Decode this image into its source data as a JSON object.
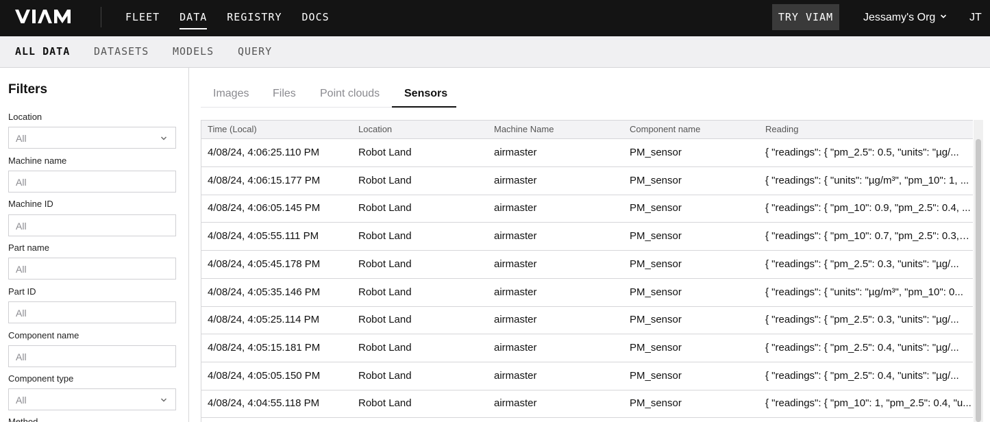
{
  "header": {
    "logo": "VIAM",
    "nav": [
      "FLEET",
      "DATA",
      "REGISTRY",
      "DOCS"
    ],
    "active_nav": "DATA",
    "try_button": "TRY VIAM",
    "org_name": "Jessamy's Org",
    "user_initials": "JT",
    "icons": {
      "org_dropdown": "chevron-down-icon"
    }
  },
  "subnav": {
    "items": [
      "ALL DATA",
      "DATASETS",
      "MODELS",
      "QUERY"
    ],
    "active": "ALL DATA"
  },
  "sidebar": {
    "title": "Filters",
    "filters": [
      {
        "label": "Location",
        "value": "All",
        "type": "select"
      },
      {
        "label": "Machine name",
        "value": "All",
        "type": "input"
      },
      {
        "label": "Machine ID",
        "value": "All",
        "type": "input"
      },
      {
        "label": "Part name",
        "value": "All",
        "type": "input"
      },
      {
        "label": "Part ID",
        "value": "All",
        "type": "input"
      },
      {
        "label": "Component name",
        "value": "All",
        "type": "input"
      },
      {
        "label": "Component type",
        "value": "All",
        "type": "select"
      }
    ],
    "partial_label": "Method"
  },
  "tabs": {
    "items": [
      "Images",
      "Files",
      "Point clouds",
      "Sensors"
    ],
    "active": "Sensors"
  },
  "table": {
    "columns": [
      "Time (Local)",
      "Location",
      "Machine Name",
      "Component name",
      "Reading"
    ],
    "rows": [
      [
        "4/08/24, 4:06:25.110 PM",
        "Robot Land",
        "airmaster",
        "PM_sensor",
        "{ \"readings\": { \"pm_2.5\": 0.5, \"units\": \"µg/..."
      ],
      [
        "4/08/24, 4:06:15.177 PM",
        "Robot Land",
        "airmaster",
        "PM_sensor",
        "{ \"readings\": { \"units\": \"µg/m³\", \"pm_10\": 1, ..."
      ],
      [
        "4/08/24, 4:06:05.145 PM",
        "Robot Land",
        "airmaster",
        "PM_sensor",
        "{ \"readings\": { \"pm_10\": 0.9, \"pm_2.5\": 0.4, ..."
      ],
      [
        "4/08/24, 4:05:55.111 PM",
        "Robot Land",
        "airmaster",
        "PM_sensor",
        "{ \"readings\": { \"pm_10\": 0.7, \"pm_2.5\": 0.3, \"..."
      ],
      [
        "4/08/24, 4:05:45.178 PM",
        "Robot Land",
        "airmaster",
        "PM_sensor",
        "{ \"readings\": { \"pm_2.5\": 0.3, \"units\": \"µg/..."
      ],
      [
        "4/08/24, 4:05:35.146 PM",
        "Robot Land",
        "airmaster",
        "PM_sensor",
        "{ \"readings\": { \"units\": \"µg/m³\", \"pm_10\": 0..."
      ],
      [
        "4/08/24, 4:05:25.114 PM",
        "Robot Land",
        "airmaster",
        "PM_sensor",
        "{ \"readings\": { \"pm_2.5\": 0.3, \"units\": \"µg/..."
      ],
      [
        "4/08/24, 4:05:15.181 PM",
        "Robot Land",
        "airmaster",
        "PM_sensor",
        "{ \"readings\": { \"pm_2.5\": 0.4, \"units\": \"µg/..."
      ],
      [
        "4/08/24, 4:05:05.150 PM",
        "Robot Land",
        "airmaster",
        "PM_sensor",
        "{ \"readings\": { \"pm_2.5\": 0.4, \"units\": \"µg/..."
      ],
      [
        "4/08/24, 4:04:55.118 PM",
        "Robot Land",
        "airmaster",
        "PM_sensor",
        "{ \"readings\": { \"pm_10\": 1, \"pm_2.5\": 0.4, \"u..."
      ]
    ]
  }
}
